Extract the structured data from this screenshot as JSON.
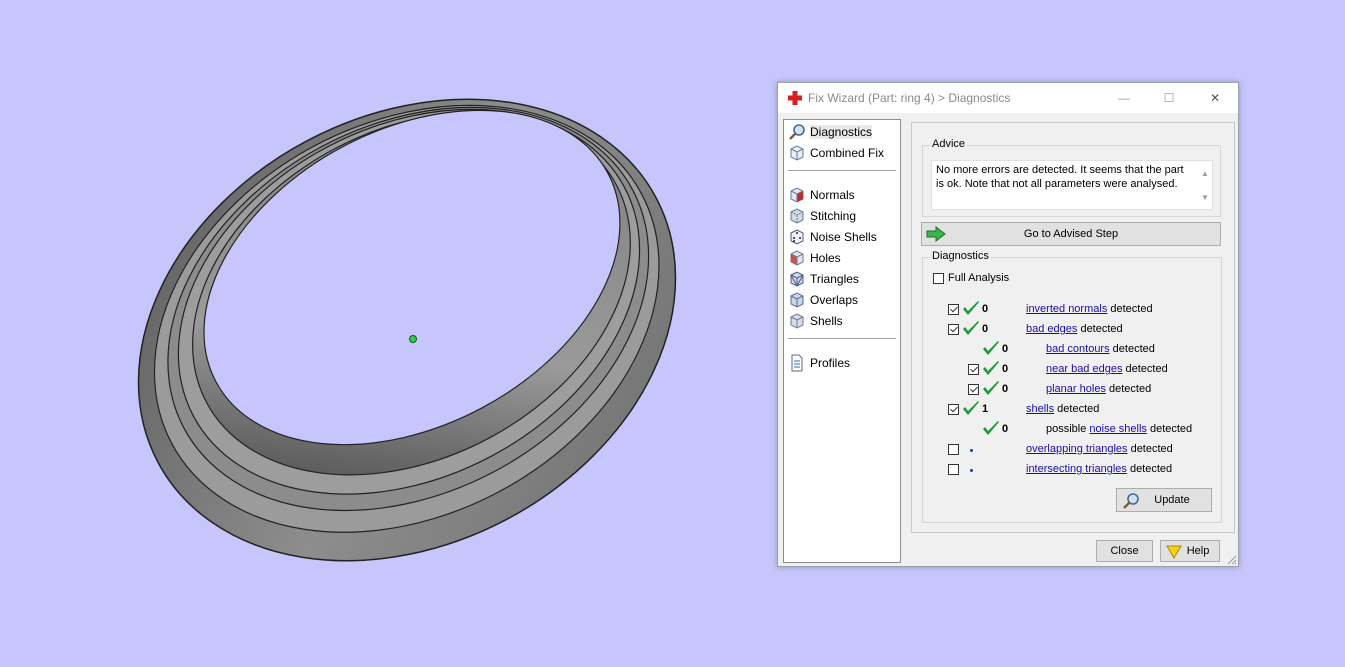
{
  "window": {
    "title": "Fix Wizard (Part: ring 4) > Diagnostics",
    "icon": "red-cross-icon",
    "minimize_label": "—",
    "maximize_label": "☐",
    "close_label": "✕"
  },
  "nav": {
    "items": [
      {
        "label": "Diagnostics",
        "icon": "magnifier-icon",
        "selected": true
      },
      {
        "label": "Combined Fix",
        "icon": "cube-icon"
      },
      {
        "label": "Normals",
        "icon": "cube-red-icon"
      },
      {
        "label": "Stitching",
        "icon": "cube-stitch-icon"
      },
      {
        "label": "Noise Shells",
        "icon": "dice-icon"
      },
      {
        "label": "Holes",
        "icon": "cube-holes-icon"
      },
      {
        "label": "Triangles",
        "icon": "cube-triangles-icon"
      },
      {
        "label": "Overlaps",
        "icon": "cube-overlaps-icon"
      },
      {
        "label": "Shells",
        "icon": "cube-shells-icon"
      },
      {
        "label": "Profiles",
        "icon": "document-icon"
      }
    ]
  },
  "advice": {
    "title": "Advice",
    "text": "No more errors are detected. It seems that the part is ok. Note that not all parameters were analysed.",
    "button_label": "Go to Advised Step"
  },
  "diagnostics": {
    "title": "Diagnostics",
    "full_analysis_label": "Full Analysis",
    "full_analysis_checked": false,
    "rows": [
      {
        "checkbox": true,
        "checked": true,
        "status": "ok",
        "count": "0",
        "pre": "",
        "link": "inverted normals",
        "post": " detected",
        "indent": 0
      },
      {
        "checkbox": true,
        "checked": true,
        "status": "ok",
        "count": "0",
        "pre": "",
        "link": "bad edges",
        "post": " detected",
        "indent": 0
      },
      {
        "checkbox": false,
        "checked": false,
        "status": "ok",
        "count": "0",
        "pre": "",
        "link": "bad contours",
        "post": " detected",
        "indent": 1
      },
      {
        "checkbox": true,
        "checked": true,
        "status": "ok",
        "count": "0",
        "pre": "",
        "link": "near bad edges",
        "post": " detected",
        "indent": 1
      },
      {
        "checkbox": true,
        "checked": true,
        "status": "ok",
        "count": "0",
        "pre": "",
        "link": "planar holes",
        "post": " detected",
        "indent": 1
      },
      {
        "checkbox": true,
        "checked": true,
        "status": "ok",
        "count": "1",
        "pre": "",
        "link": "shells",
        "post": " detected",
        "indent": 0
      },
      {
        "checkbox": false,
        "checked": false,
        "status": "ok",
        "count": "0",
        "pre": "possible ",
        "link": "noise shells",
        "post": " detected",
        "indent": 1
      },
      {
        "checkbox": true,
        "checked": false,
        "status": "dot",
        "count": "",
        "pre": "",
        "link": "overlapping triangles",
        "post": " detected",
        "indent": 0
      },
      {
        "checkbox": true,
        "checked": false,
        "status": "dot",
        "count": "",
        "pre": "",
        "link": "intersecting triangles",
        "post": " detected",
        "indent": 0
      }
    ],
    "update_label": "Update"
  },
  "footer": {
    "close_label": "Close",
    "help_label": "Help"
  },
  "colors": {
    "viewport_background": "#c6c6fc",
    "ring": "#8a8a8a",
    "check_green": "#1e9a3a",
    "link": "#1a0dab"
  }
}
